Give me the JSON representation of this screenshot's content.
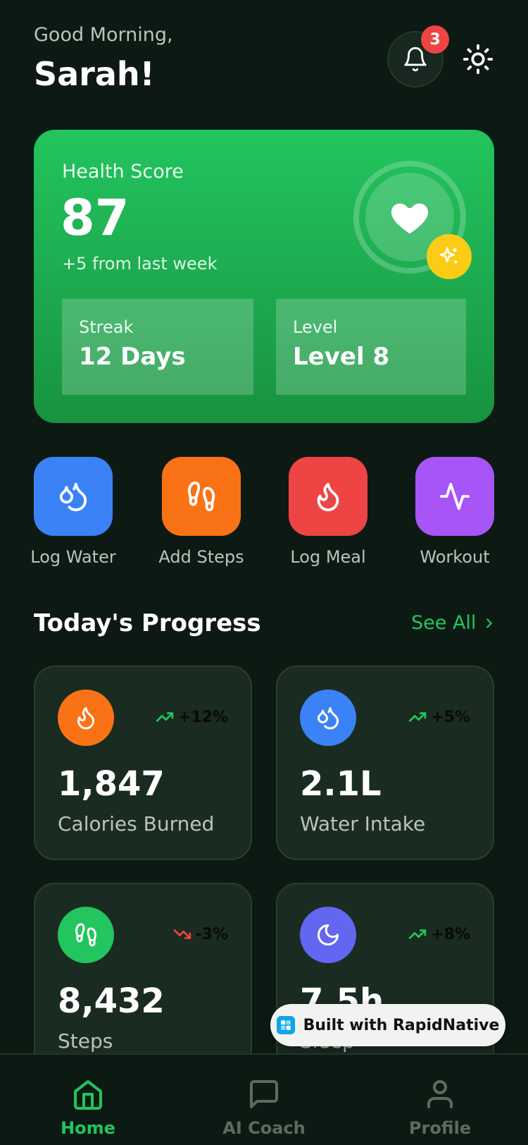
{
  "header": {
    "greeting": "Good Morning,",
    "username": "Sarah!",
    "notification_count": "3"
  },
  "health_card": {
    "label": "Health Score",
    "score": "87",
    "delta": "+5 from last week",
    "streak": {
      "label": "Streak",
      "value": "12 Days"
    },
    "level": {
      "label": "Level",
      "value": "Level 8"
    }
  },
  "quick_actions": [
    {
      "label": "Log Water",
      "icon": "droplets-icon",
      "color": "#3b82f6"
    },
    {
      "label": "Add Steps",
      "icon": "footprints-icon",
      "color": "#f97316"
    },
    {
      "label": "Log Meal",
      "icon": "flame-icon",
      "color": "#ef4444"
    },
    {
      "label": "Workout",
      "icon": "activity-icon",
      "color": "#a855f7"
    }
  ],
  "progress": {
    "title": "Today's Progress",
    "see_all": "See All",
    "metrics": [
      {
        "value": "1,847",
        "label": "Calories Burned",
        "trend": "+12%",
        "trend_dir": "up",
        "icon": "flame-icon",
        "color": "#f97316"
      },
      {
        "value": "2.1L",
        "label": "Water Intake",
        "trend": "+5%",
        "trend_dir": "up",
        "icon": "droplets-icon",
        "color": "#3b82f6"
      },
      {
        "value": "8,432",
        "label": "Steps",
        "trend": "-3%",
        "trend_dir": "down",
        "icon": "footprints-icon",
        "color": "#22c55e"
      },
      {
        "value": "7.5h",
        "label": "Sleep",
        "trend": "+8%",
        "trend_dir": "up",
        "icon": "moon-icon",
        "color": "#6366f1"
      }
    ]
  },
  "built_badge": "Built with RapidNative",
  "nav": [
    {
      "label": "Home",
      "icon": "home-icon",
      "active": true
    },
    {
      "label": "AI Coach",
      "icon": "chat-icon",
      "active": false
    },
    {
      "label": "Profile",
      "icon": "user-icon",
      "active": false
    }
  ],
  "colors": {
    "background": "#0d1a14",
    "accent": "#22c55e",
    "card": "#1a2b21",
    "trend_up": "#22c55e",
    "trend_down": "#ef4444"
  }
}
